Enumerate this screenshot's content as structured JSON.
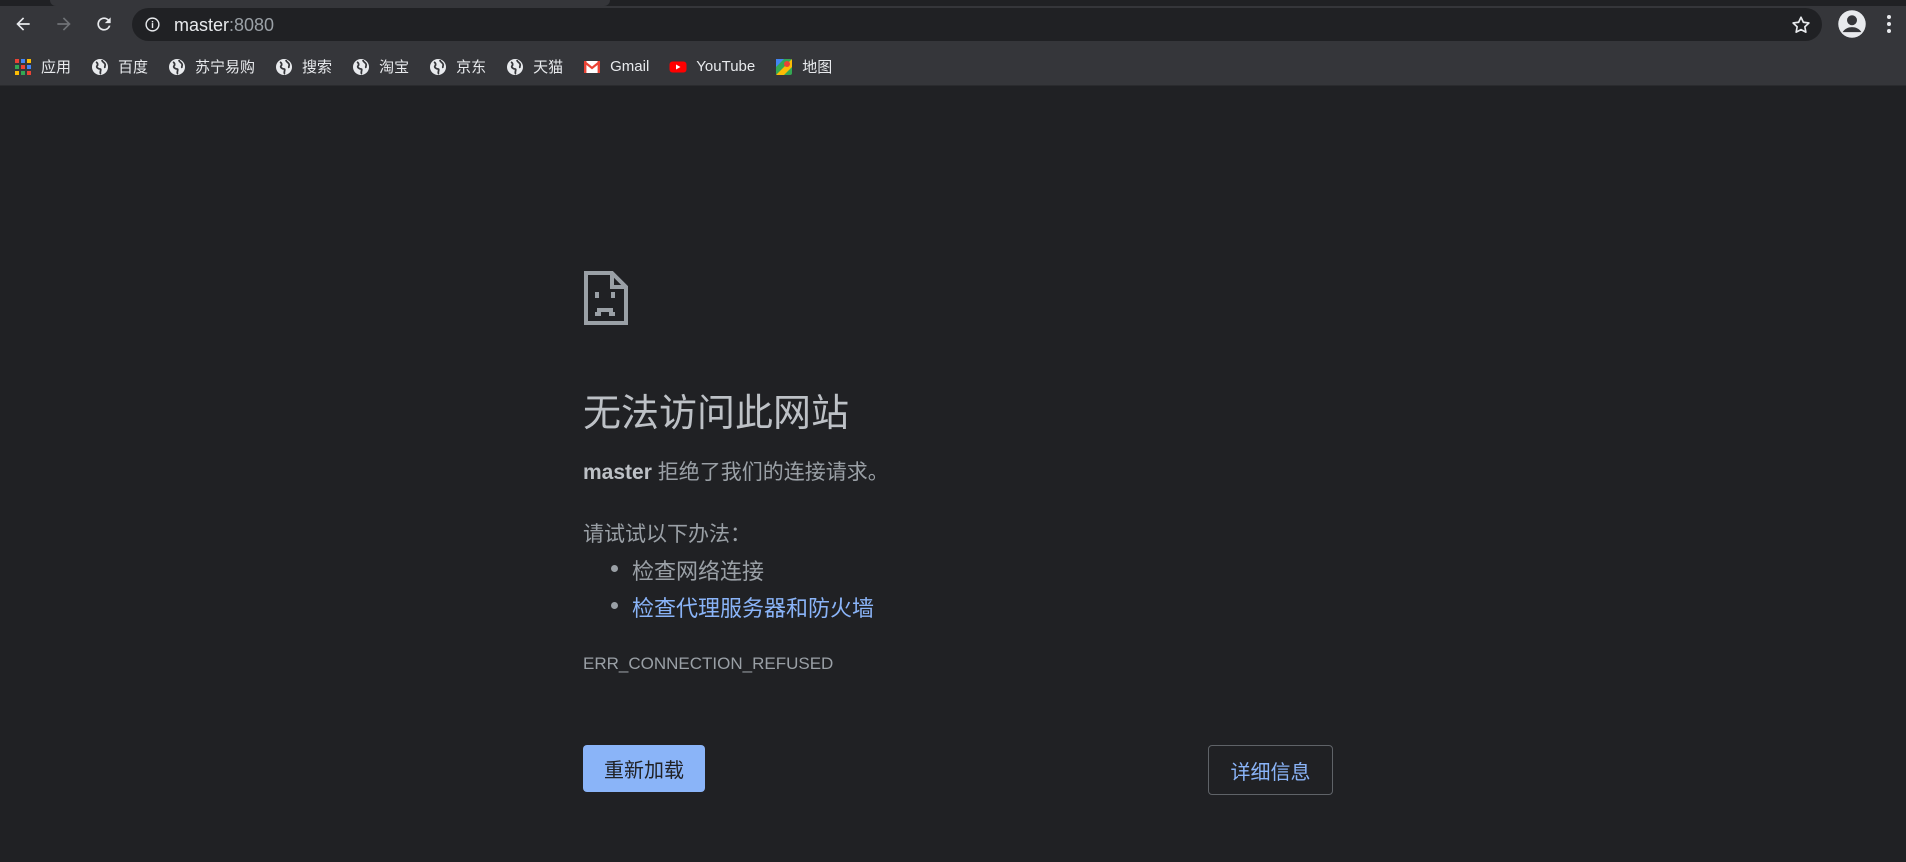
{
  "browser": {
    "url_host": "master",
    "url_port": ":8080",
    "bookmarks": [
      {
        "label": "应用",
        "icon": "apps-grid-icon"
      },
      {
        "label": "百度",
        "icon": "globe-icon"
      },
      {
        "label": "苏宁易购",
        "icon": "globe-icon"
      },
      {
        "label": "搜索",
        "icon": "globe-icon"
      },
      {
        "label": "淘宝",
        "icon": "globe-icon"
      },
      {
        "label": "京东",
        "icon": "globe-icon"
      },
      {
        "label": "天猫",
        "icon": "globe-icon"
      },
      {
        "label": "Gmail",
        "icon": "gmail-icon"
      },
      {
        "label": "YouTube",
        "icon": "youtube-icon"
      },
      {
        "label": "地图",
        "icon": "maps-icon"
      }
    ]
  },
  "error_page": {
    "heading": "无法访问此网站",
    "host": "master",
    "message": " 拒绝了我们的连接请求。",
    "try_title": "请试试以下办法：",
    "suggestions": [
      {
        "text": "检查网络连接",
        "link": false
      },
      {
        "text": "检查代理服务器和防火墙",
        "link": true
      }
    ],
    "error_code": "ERR_CONNECTION_REFUSED",
    "reload_label": "重新加载",
    "details_label": "详细信息"
  },
  "colors": {
    "background": "#202124",
    "toolbar": "#35363a",
    "accent": "#8ab4f8"
  }
}
